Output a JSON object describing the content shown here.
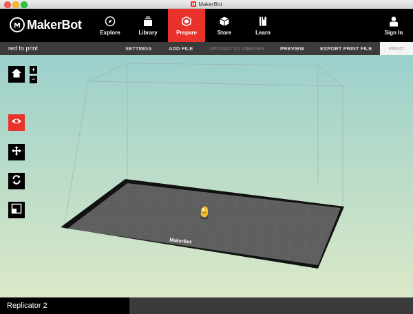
{
  "window": {
    "title": "MakerBot"
  },
  "nav": {
    "logo_text": "MakerBot",
    "items": [
      {
        "label": "Explore",
        "icon": "compass-icon"
      },
      {
        "label": "Library",
        "icon": "library-icon"
      },
      {
        "label": "Prepare",
        "icon": "prepare-cube-icon",
        "active": true
      },
      {
        "label": "Store",
        "icon": "store-box-icon"
      },
      {
        "label": "Learn",
        "icon": "book-icon"
      }
    ],
    "sign_in": "Sign In"
  },
  "toolbar": {
    "file_name": "red to print",
    "settings": "SETTINGS",
    "add_file": "ADD FILE",
    "upload": "UPLOAD TO LIBRARY",
    "preview": "PREVIEW",
    "export": "EXPORT PRINT FILE",
    "print": "PRINT"
  },
  "viewport": {
    "zoom_in": "+",
    "zoom_out": "−",
    "plate_logo": "MakerBot",
    "tools": [
      "home-icon",
      "eye-icon",
      "move-icon",
      "rotate-icon",
      "scale-icon"
    ],
    "active_tool": "eye-icon"
  },
  "status": {
    "printer": "Replicator 2"
  },
  "colors": {
    "accent": "#e8322a",
    "toolbar": "#3b3b3b",
    "nav": "#000000"
  }
}
